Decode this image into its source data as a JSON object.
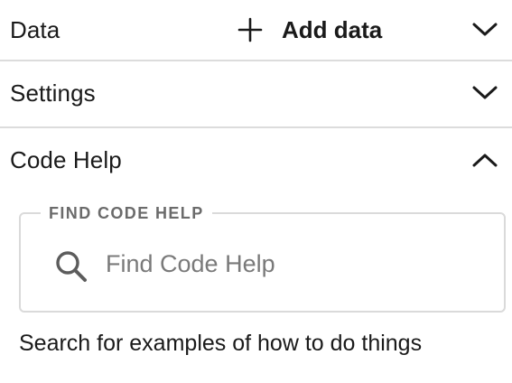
{
  "sections": {
    "data": {
      "title": "Data",
      "add_label": "Add data",
      "add_icon": "plus-icon",
      "chevron": "chevron-down-icon",
      "expanded": false
    },
    "settings": {
      "title": "Settings",
      "chevron": "chevron-down-icon",
      "expanded": false
    },
    "code_help": {
      "title": "Code Help",
      "chevron": "chevron-up-icon",
      "expanded": true,
      "field_legend": "FIND CODE HELP",
      "search_icon": "search-icon",
      "search_placeholder": "Find Code Help",
      "search_value": "",
      "hint": "Search for examples of how to do things"
    }
  },
  "colors": {
    "text": "#1a1a1a",
    "divider": "#dcdcdc",
    "field_border": "#dadada",
    "legend": "#6b6b6b",
    "placeholder": "#7a7a7a"
  }
}
